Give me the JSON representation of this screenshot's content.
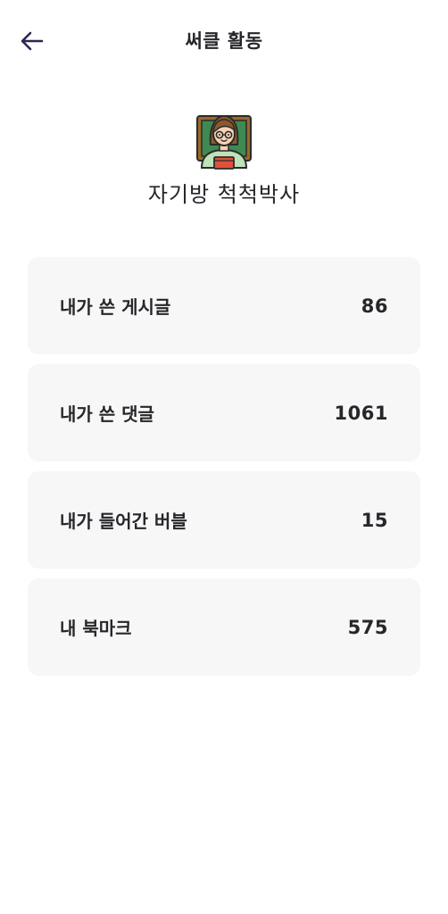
{
  "header": {
    "title": "써클 활동",
    "back_icon": "arrow-left-icon"
  },
  "profile": {
    "name": "자기방 척척박사",
    "avatar_icon": "avatar-icon"
  },
  "stats": [
    {
      "label": "내가 쓴 게시글",
      "value": "86"
    },
    {
      "label": "내가 쓴 댓글",
      "value": "1061"
    },
    {
      "label": "내가 들어간 버블",
      "value": "15"
    },
    {
      "label": "내 북마크",
      "value": "575"
    }
  ],
  "colors": {
    "background": "#ffffff",
    "card": "#f7f7f7",
    "text": "#26262b",
    "icon": "#2a2850"
  }
}
